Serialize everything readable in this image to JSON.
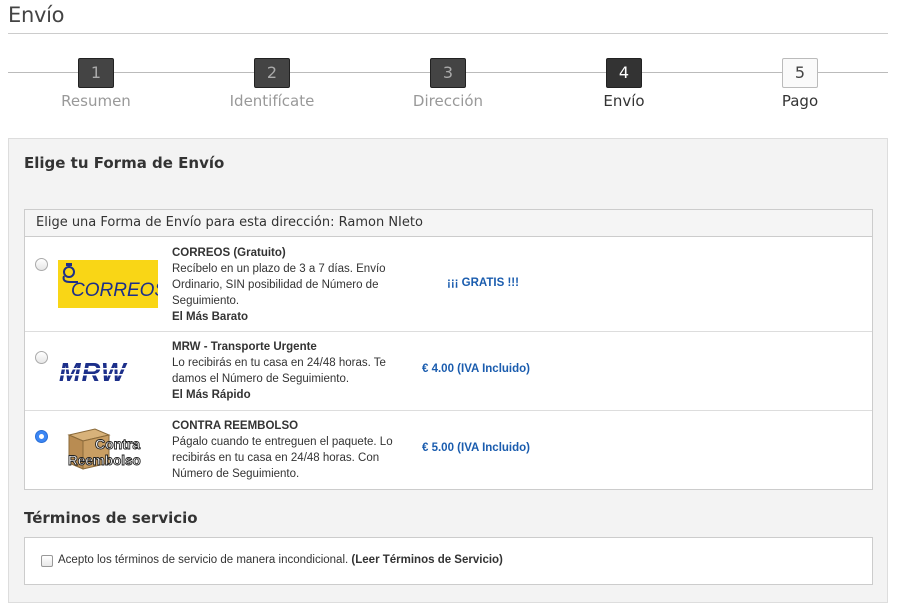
{
  "page": {
    "title": "Envío"
  },
  "steps": [
    {
      "number": "1",
      "label": "Resumen",
      "state": "done"
    },
    {
      "number": "2",
      "label": "Identifícate",
      "state": "done"
    },
    {
      "number": "3",
      "label": "Dirección",
      "state": "done"
    },
    {
      "number": "4",
      "label": "Envío",
      "state": "current"
    },
    {
      "number": "5",
      "label": "Pago",
      "state": "future"
    }
  ],
  "shipping": {
    "heading": "Elige tu Forma de Envío",
    "box_header": "Elige una Forma de Envío para esta dirección: Ramon NIeto",
    "options": [
      {
        "title": "CORREOS (Gratuito)",
        "description": "Recíbelo en un plazo de 3 a 7 días. Envío Ordinario, SIN posibilidad de Número de Seguimiento.",
        "tag": "El Más Barato",
        "price": "¡¡¡ GRATIS !!!",
        "selected": false,
        "logo_text": "CORREOS",
        "logo_icon": "correos-posthorn-logo"
      },
      {
        "title": "MRW - Transporte Urgente",
        "description": "Lo recibirás en tu casa en 24/48 horas. Te damos el Número de Seguimiento.",
        "tag": "El Más Rápido",
        "price": "€ 4.00 (IVA Incluido)",
        "selected": false,
        "logo_text": "MRW",
        "logo_icon": "mrw-logo"
      },
      {
        "title": "CONTRA REEMBOLSO",
        "description": "Págalo cuando te entreguen el paquete. Lo recibirás en tu casa en 24/48 horas. Con Número de Seguimiento.",
        "tag": "",
        "price": "€ 5.00 (IVA Incluido)",
        "selected": true,
        "logo_text_1": "Contra",
        "logo_text_2": "Reembolso",
        "logo_icon": "cardboard-box-logo"
      }
    ]
  },
  "terms": {
    "heading": "Términos de servicio",
    "text": "Acepto los términos de servicio de manera incondicional.",
    "link": "(Leer Términos de Servicio)",
    "checked": false
  },
  "colors": {
    "price": "#1a5cae",
    "radio_selected": "#3b86f4",
    "correos_yellow": "#f9d616",
    "mrw_blue": "#1c2f8a"
  }
}
